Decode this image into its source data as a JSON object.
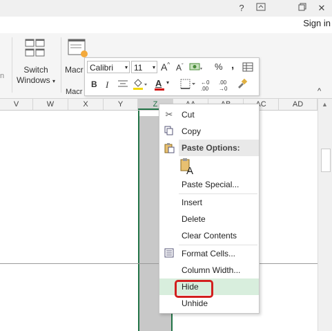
{
  "window": {
    "help_label": "?",
    "restore_ribbon_label": "⌃",
    "restore_label": "❐",
    "close_label": "✕",
    "signin": "Sign in"
  },
  "ribbon": {
    "left_fragment": "n",
    "switch_windows_line1": "Switch",
    "switch_windows_line2": "Windows",
    "macros_partial": "Macr",
    "macros_group_partial": "Macr",
    "collapse_label": "^"
  },
  "minitoolbar": {
    "font_name": "Calibri",
    "font_size": "11",
    "grow_font": "A",
    "shrink_font": "A",
    "percent": "%",
    "comma": ",",
    "bold": "B",
    "italic": "I",
    "font_color_label": "A",
    "inc_decimal": "←0 .00",
    "dec_decimal": ".00 →0"
  },
  "columns": [
    "V",
    "W",
    "X",
    "Y",
    "Z",
    "AA",
    "AB",
    "AC",
    "AD"
  ],
  "context_menu": {
    "cut": "Cut",
    "copy": "Copy",
    "paste_options": "Paste Options:",
    "paste_special": "Paste Special...",
    "insert": "Insert",
    "delete": "Delete",
    "clear_contents": "Clear Contents",
    "format_cells": "Format Cells...",
    "column_width": "Column Width...",
    "hide": "Hide",
    "unhide": "Unhide"
  },
  "colors": {
    "accent": "#217346",
    "highlight_ring": "#d21f1f",
    "hover_row": "#d8eedd"
  }
}
